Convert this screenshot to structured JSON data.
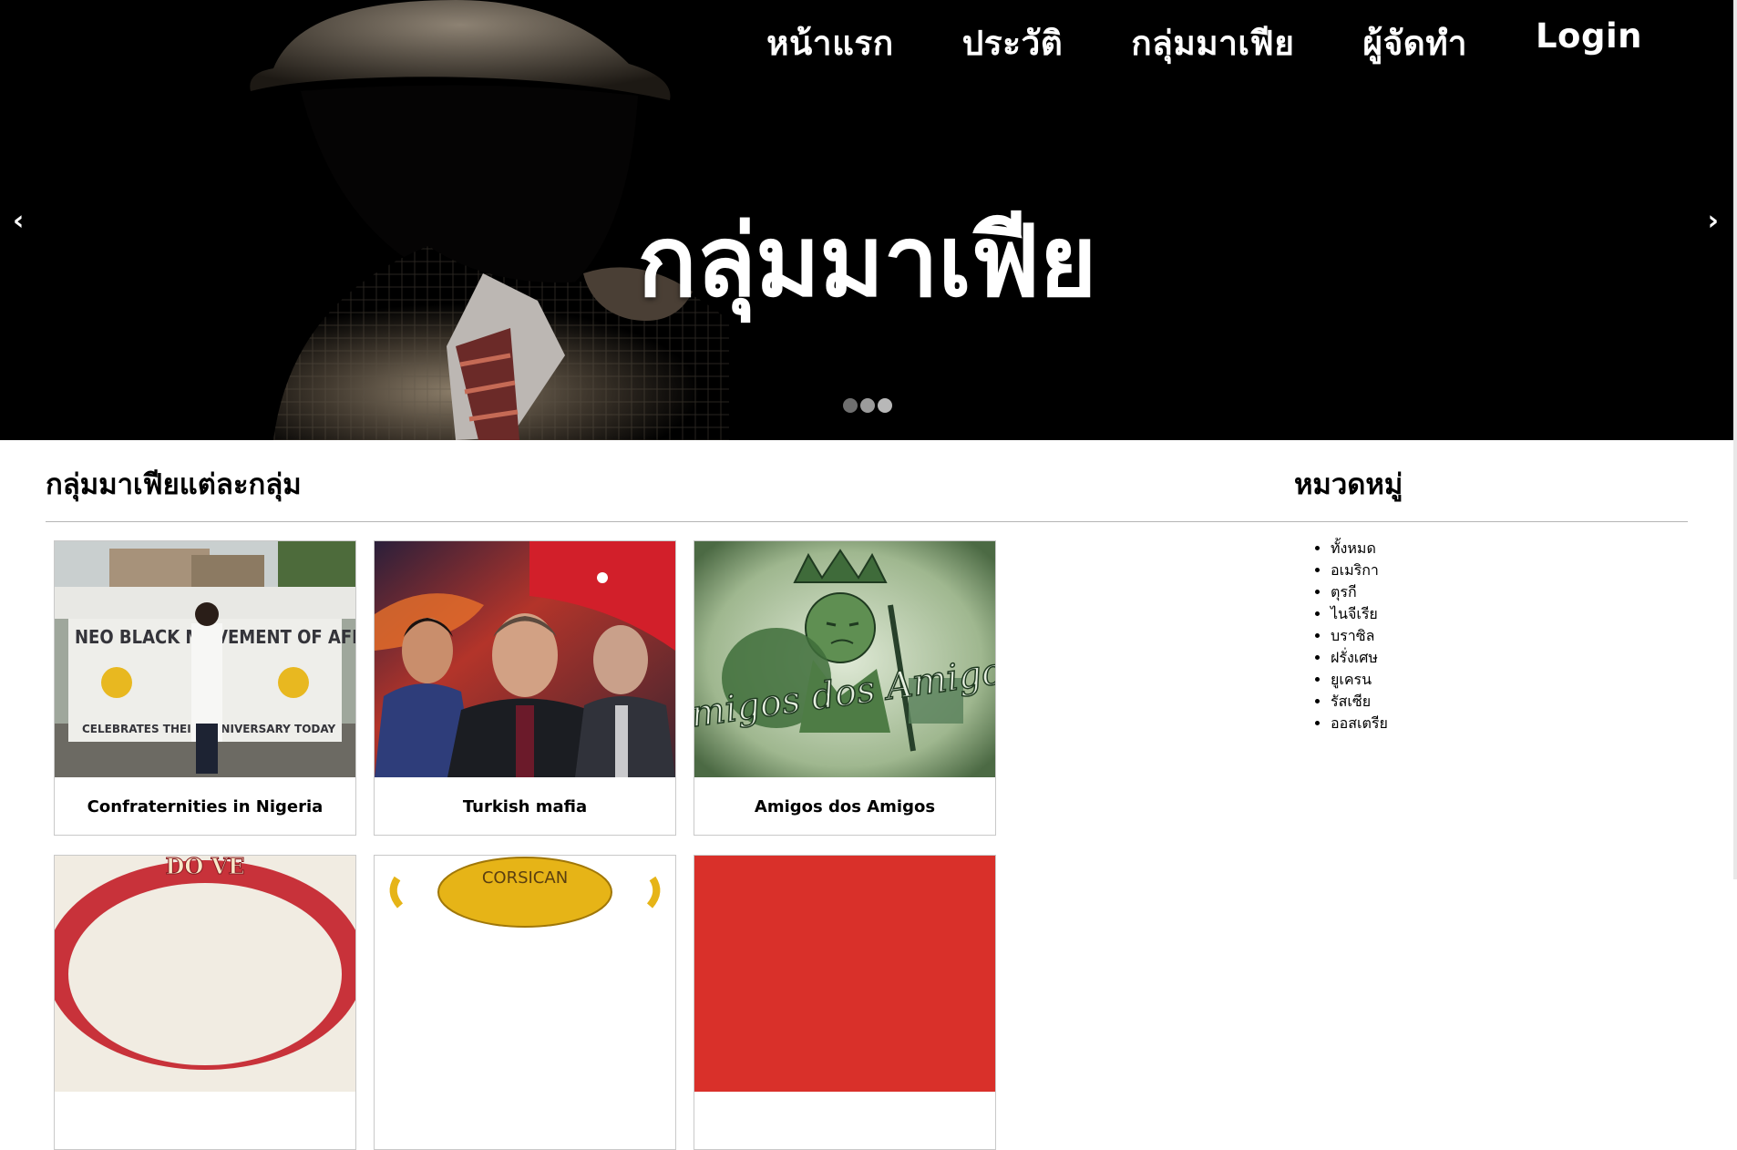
{
  "nav": {
    "items": [
      "หน้าแรก",
      "ประวัติ",
      "กลุ่มมาเฟีย",
      "ผู้จัดทำ",
      "Login"
    ]
  },
  "hero": {
    "title": "กลุ่มมาเฟีย",
    "prev_arrow": "‹",
    "next_arrow": "›",
    "slide_count": 3,
    "active_slide": 1
  },
  "main": {
    "title": "กลุ่มมาเฟียแต่ละกลุ่ม",
    "cards": [
      {
        "label": "Confraternities in Nigeria",
        "image": "protest-banner-photo",
        "banner_text": "NEO BLACK MOVEMENT OF AFRICA",
        "banner_sub": "CELEBRATES THEIR ANNIVERSARY TODAY"
      },
      {
        "label": "Turkish mafia",
        "image": "three-men-flag-photo"
      },
      {
        "label": "Amigos dos Amigos",
        "image": "green-crown-logo",
        "logo_text": "Amigos dos Amigos"
      },
      {
        "label": "",
        "image": "red-emblem-partial",
        "banner_text": "DO VE"
      },
      {
        "label": "",
        "image": "corsican-logo-partial",
        "banner_text": "CORSICAN"
      },
      {
        "label": "",
        "image": "red-block-partial"
      }
    ]
  },
  "sidebar": {
    "title": "หมวดหมู่",
    "items": [
      "ทั้งหมด",
      "อเมริกา",
      "ตุรกี",
      "ไนจีเรีย",
      "บราซิล",
      "ฝรั่งเศษ",
      "ยูเครน",
      "รัสเซีย",
      "ออสเตรีย"
    ]
  },
  "colors": {
    "hero_bg": "#000000",
    "rule": "#b5b5b5",
    "text": "#000000"
  }
}
